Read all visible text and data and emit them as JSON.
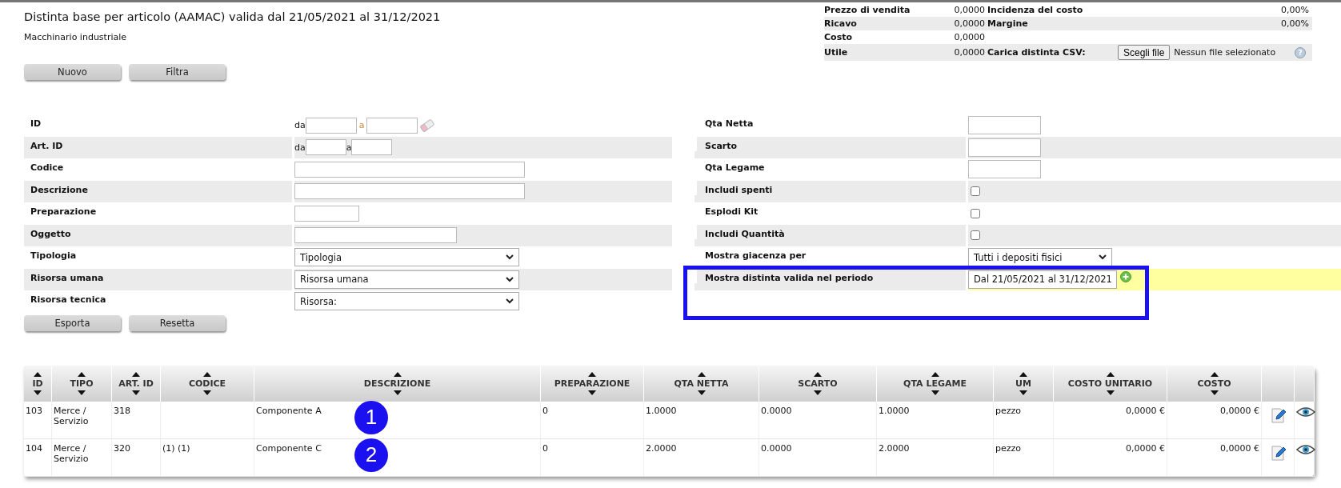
{
  "page": {
    "title": "Distinta base per articolo (AAMAC) valida dal 21/05/2021 al 31/12/2021",
    "subtitle": "Macchinario industriale"
  },
  "summary": [
    {
      "kind": "pair",
      "label": "Prezzo di vendita",
      "value": "0,0000",
      "label_2": "Incidenza del costo",
      "value_2": "0,00%"
    },
    {
      "kind": "pair",
      "label": "Ricavo",
      "value": "0,0000",
      "label_2": "Margine",
      "value_2": "0,00%"
    },
    {
      "kind": "single",
      "label": "Costo",
      "value": "0,0000"
    },
    {
      "kind": "file",
      "label": "Utile",
      "value": "0,0000",
      "label_2": "Carica distinta CSV:",
      "button": "Scegli file",
      "file_status": "Nessun file selezionato",
      "help": "?"
    }
  ],
  "top_buttons": [
    "Nuovo",
    "Filtra"
  ],
  "filters_left": [
    {
      "kind": "range",
      "label": "ID",
      "from_label": "da",
      "to_label": "a",
      "clear_button": true
    },
    {
      "kind": "range",
      "label": "Art. ID",
      "from_label": "da",
      "to_label": "a",
      "clear_button": false
    },
    {
      "kind": "wide",
      "label": "Codice"
    },
    {
      "kind": "wide",
      "label": "Descrizione"
    },
    {
      "kind": "short",
      "label": "Preparazione"
    },
    {
      "kind": "medium",
      "label": "Oggetto"
    },
    {
      "kind": "select",
      "label": "Tipologia",
      "value": "Tipologia"
    },
    {
      "kind": "select",
      "label": "Risorsa umana",
      "value": "Risorsa umana"
    },
    {
      "kind": "select",
      "label": "Risorsa tecnica",
      "value": "Risorsa:"
    }
  ],
  "filters_right": [
    {
      "kind": "text",
      "label": "Qta Netta"
    },
    {
      "kind": "text",
      "label": "Scarto"
    },
    {
      "kind": "text",
      "label": "Qta Legame"
    },
    {
      "kind": "checkbox",
      "label": "Includi spenti",
      "checked": false
    },
    {
      "kind": "checkbox",
      "label": "Esplodi Kit",
      "checked": false
    },
    {
      "kind": "checkbox",
      "label": "Includi Quantità",
      "checked": false
    },
    {
      "kind": "select",
      "label": "Mostra giacenza per",
      "value": "Tutti i depositi fisici",
      "highlighted": false,
      "add_button": false,
      "annotated": false
    },
    {
      "kind": "select",
      "label": "Mostra distinta valida nel periodo",
      "value": "Dal 21/05/2021 al 31/12/2021",
      "highlighted": true,
      "add_button": true,
      "annotated": true
    }
  ],
  "bottom_buttons": [
    "Esporta",
    "Resetta"
  ],
  "table": {
    "columns": [
      {
        "label": "ID",
        "kind": "text"
      },
      {
        "label": "TIPO",
        "kind": "text"
      },
      {
        "label": "ART. ID",
        "kind": "text"
      },
      {
        "label": "CODICE",
        "kind": "text"
      },
      {
        "label": "DESCRIZIONE",
        "kind": "text"
      },
      {
        "label": "PREPARAZIONE",
        "kind": "text"
      },
      {
        "label": "QTA NETTA",
        "kind": "text"
      },
      {
        "label": "SCARTO",
        "kind": "text"
      },
      {
        "label": "QTA LEGAME",
        "kind": "text"
      },
      {
        "label": "UM",
        "kind": "text"
      },
      {
        "label": "COSTO UNITARIO",
        "kind": "currency"
      },
      {
        "label": "COSTO",
        "kind": "currency"
      }
    ],
    "rows": [
      {
        "cells": [
          "103",
          "Merce / Servizio",
          "318",
          "",
          "Componente A",
          "0",
          "1.0000",
          "0.0000",
          "1.0000",
          "pezzo",
          "0,0000 €",
          "0,0000 €"
        ],
        "marker": "1"
      },
      {
        "cells": [
          "104",
          "Merce / Servizio",
          "320",
          "(1) (1)",
          "Componente C",
          "0",
          "2.0000",
          "0.0000",
          "2.0000",
          "pezzo",
          "0,0000 €",
          "0,0000 €"
        ],
        "marker": "2"
      }
    ]
  }
}
